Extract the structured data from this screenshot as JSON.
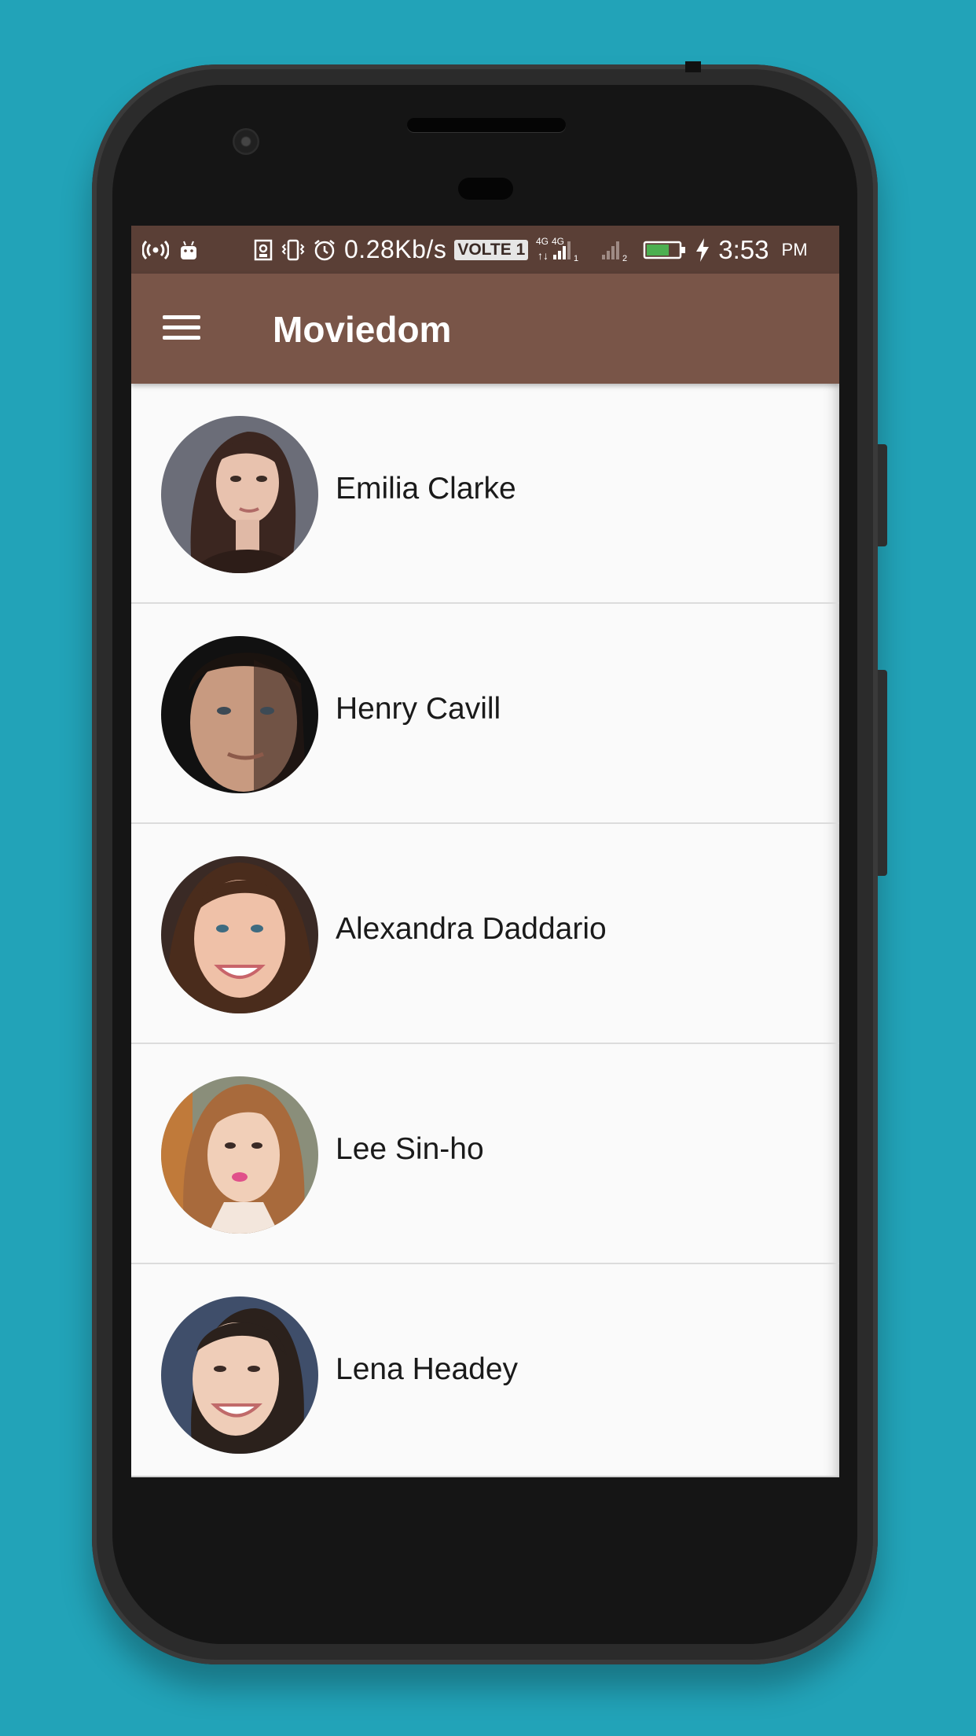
{
  "status_bar": {
    "net_speed": "0.28Kb/s",
    "volte": "VOLTE 1",
    "network_type_1": "4G",
    "network_type_2": "4G",
    "sim_1": "1",
    "sim_2": "2",
    "time": "3:53",
    "ampm": "PM",
    "battery_level": 0.7,
    "battery_color": "#4caf50",
    "icons": [
      "hotspot-icon",
      "android-notification-icon",
      "nfc-icon",
      "vibrate-icon",
      "alarm-icon",
      "signal-icon",
      "battery-icon",
      "charging-icon"
    ]
  },
  "app_bar": {
    "title": "Moviedom",
    "menu_icon": "hamburger-menu-icon",
    "color": "#795548"
  },
  "people": [
    {
      "name": "Emilia Clarke",
      "avatar": "photo-avatar"
    },
    {
      "name": "Henry Cavill",
      "avatar": "photo-avatar"
    },
    {
      "name": "Alexandra Daddario",
      "avatar": "photo-avatar"
    },
    {
      "name": "Lee Sin-ho",
      "avatar": "photo-avatar"
    },
    {
      "name": "Lena Headey",
      "avatar": "photo-avatar"
    }
  ],
  "colors": {
    "background": "#22a3b8",
    "status_bar": "#5a3f36",
    "list_background": "#fafafa"
  }
}
